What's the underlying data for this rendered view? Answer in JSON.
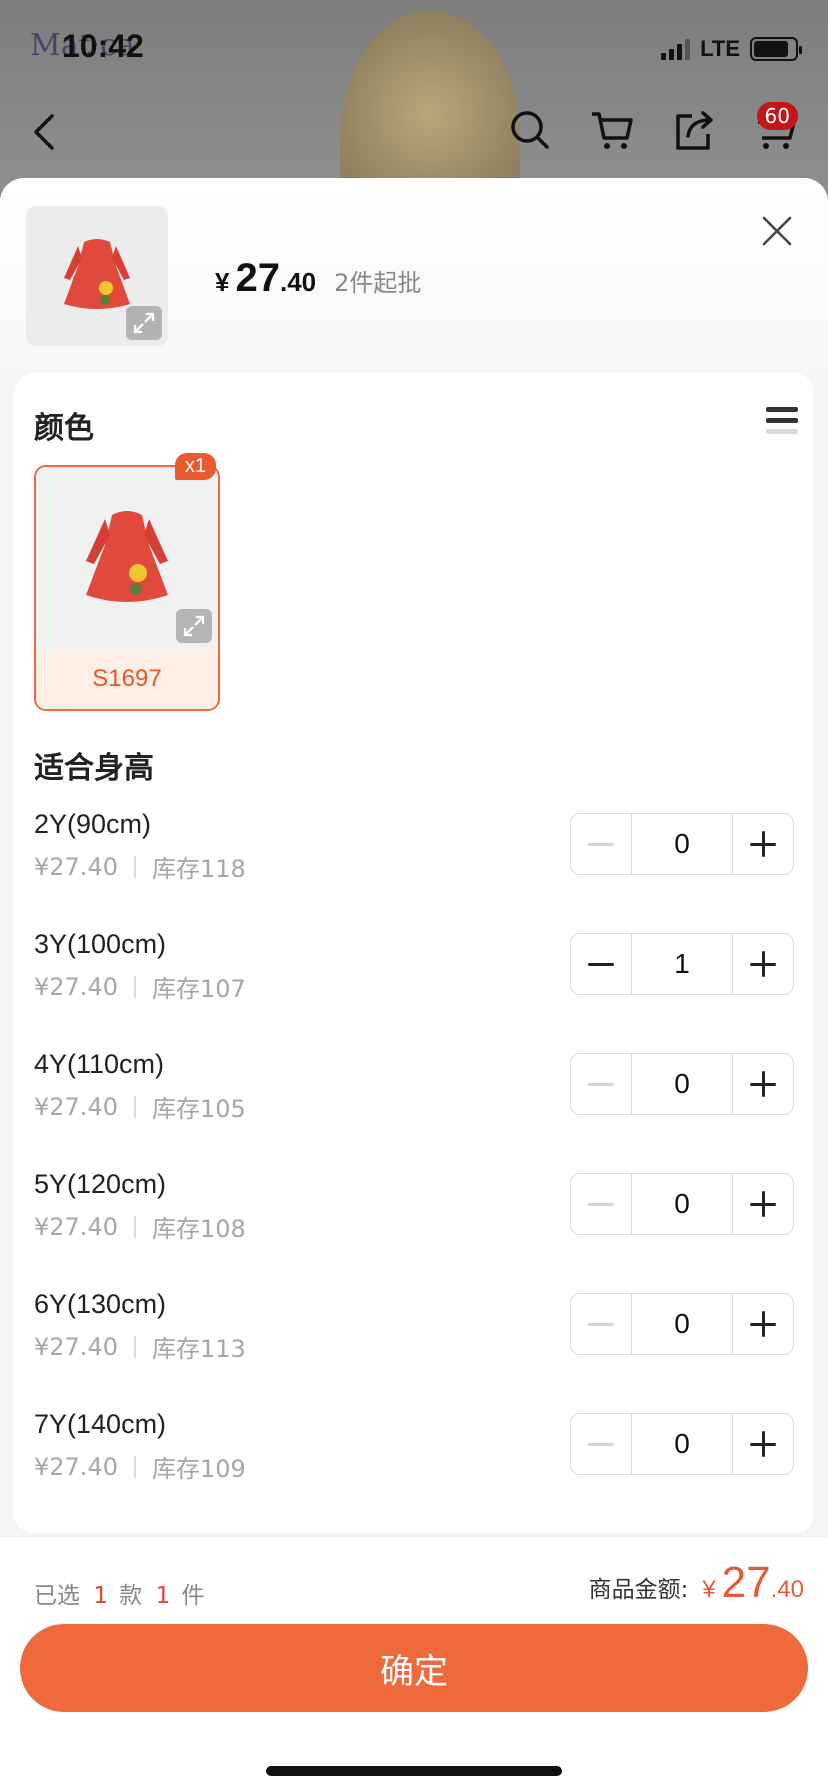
{
  "status_bar": {
    "time": "10:42",
    "network": "LTE"
  },
  "background": {
    "logo": "Mat·ca",
    "cart_badge": "60"
  },
  "product": {
    "currency": "¥",
    "price_int": "27",
    "price_dec": ".40",
    "moq": "2件起批"
  },
  "color_section": {
    "title": "颜色",
    "option_label": "S1697",
    "option_qty_badge": "x1"
  },
  "size_section": {
    "title": "适合身高",
    "rows": [
      {
        "name": "2Y(90cm)",
        "price": "¥27.40",
        "stock": "库存118",
        "qty": "0"
      },
      {
        "name": "3Y(100cm)",
        "price": "¥27.40",
        "stock": "库存107",
        "qty": "1"
      },
      {
        "name": "4Y(110cm)",
        "price": "¥27.40",
        "stock": "库存105",
        "qty": "0"
      },
      {
        "name": "5Y(120cm)",
        "price": "¥27.40",
        "stock": "库存108",
        "qty": "0"
      },
      {
        "name": "6Y(130cm)",
        "price": "¥27.40",
        "stock": "库存113",
        "qty": "0"
      },
      {
        "name": "7Y(140cm)",
        "price": "¥27.40",
        "stock": "库存109",
        "qty": "0"
      }
    ]
  },
  "footer": {
    "selected_prefix": "已选",
    "styles_count": "1",
    "styles_unit": "款",
    "items_count": "1",
    "items_unit": "件",
    "amount_label": "商品金额:",
    "currency": "¥",
    "amount_int": "27",
    "amount_dec": ".40",
    "confirm_label": "确定"
  },
  "colors": {
    "accent": "#EE6A3C",
    "price_red": "#E8583A"
  }
}
